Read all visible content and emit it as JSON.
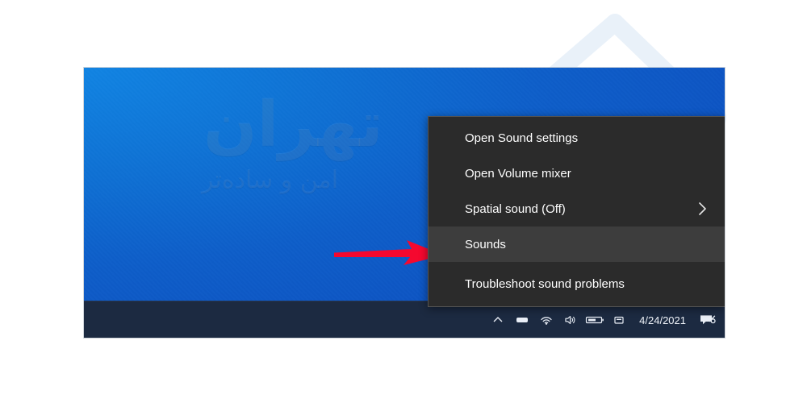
{
  "watermark": {
    "logo_icon": "house-outline-logo",
    "logo_color": "#e8f0f9",
    "desktop_text_main": "تهران",
    "desktop_text_sub": "امن و ساده‌تر"
  },
  "desktop": {
    "accent_color": "#0e5ec9",
    "annotation": {
      "arrow_icon": "right-arrow-annotation",
      "arrow_color": "#f5082f"
    }
  },
  "taskbar": {
    "background_color": "#1c2a41",
    "clock": "4/24/2021",
    "tray_icons": [
      {
        "name": "show-hidden-icons-chevron",
        "glyph": "⌃"
      },
      {
        "name": "onedrive-icon",
        "glyph": "▭"
      },
      {
        "name": "network-wifi-icon",
        "glyph": "wifi"
      },
      {
        "name": "volume-speaker-icon",
        "glyph": "speaker"
      },
      {
        "name": "battery-icon",
        "glyph": "battery"
      },
      {
        "name": "keyboard-language-icon",
        "glyph": "kbd"
      }
    ],
    "notification_icon": "action-center-notification-icon"
  },
  "context_menu": {
    "background_color": "#2b2b2b",
    "highlight_color": "#3d3d3d",
    "items": [
      {
        "label": "Open Sound settings",
        "submenu": false,
        "selected": false
      },
      {
        "label": "Open Volume mixer",
        "submenu": false,
        "selected": false
      },
      {
        "label": "Spatial sound (Off)",
        "submenu": true,
        "submenu_icon": "chevron-right-icon",
        "selected": false
      },
      {
        "label": "Sounds",
        "submenu": false,
        "selected": true
      },
      {
        "label": "Troubleshoot sound problems",
        "submenu": false,
        "selected": false
      }
    ]
  }
}
